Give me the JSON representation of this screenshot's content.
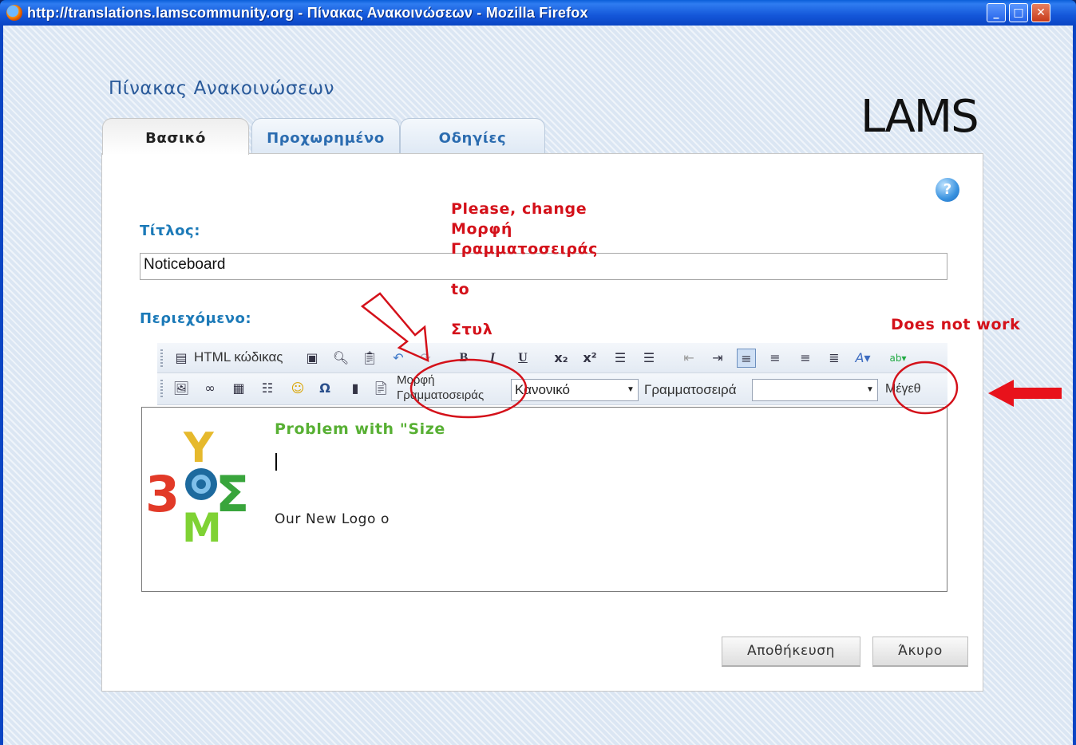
{
  "window": {
    "title": "http://translations.lamscommunity.org - Πίνακας Ανακοινώσεων - Mozilla Firefox",
    "buttons": {
      "minimize": "_",
      "maximize": "□",
      "close": "✕"
    }
  },
  "page": {
    "heading": "Πίνακας Ανακοινώσεων",
    "logo_text": "LAMS",
    "tabs": [
      {
        "label": "Βασικό",
        "active": true
      },
      {
        "label": "Προχωρημένο",
        "active": false
      },
      {
        "label": "Οδηγίες",
        "active": false
      }
    ],
    "help_icon": "?"
  },
  "form": {
    "title_label": "Τίτλος:",
    "title_value": "Noticeboard",
    "content_label": "Περιεχόμενο:"
  },
  "toolbar": {
    "html_source": "HTML κώδικας",
    "format_label_line1": "Μορφή",
    "format_label_line2": "Γραμματοσειράς",
    "format_value": "Κανονικό",
    "font_label": "Γραμματοσειρά",
    "font_value": "",
    "size_label": "Μέγεθ",
    "bold": "B",
    "italic": "I",
    "underline": "U",
    "subscript": "x₂",
    "superscript": "x²",
    "omega": "Ω"
  },
  "editor_content": {
    "heading": "Problem with \"Size",
    "text": "Our New Logo o"
  },
  "annotations": {
    "change_line1": "Please, change",
    "change_line2": "Μορφή",
    "change_line3": "Γραμματοσειράς",
    "change_to": "to",
    "change_target": "Στυλ",
    "does_not_work": "Does not work"
  },
  "buttons": {
    "save": "Αποθήκευση",
    "cancel": "Άκυρο"
  },
  "colors": {
    "annotation_red": "#d4111a",
    "label_blue": "#1c7ab8",
    "content_green": "#58b034"
  }
}
